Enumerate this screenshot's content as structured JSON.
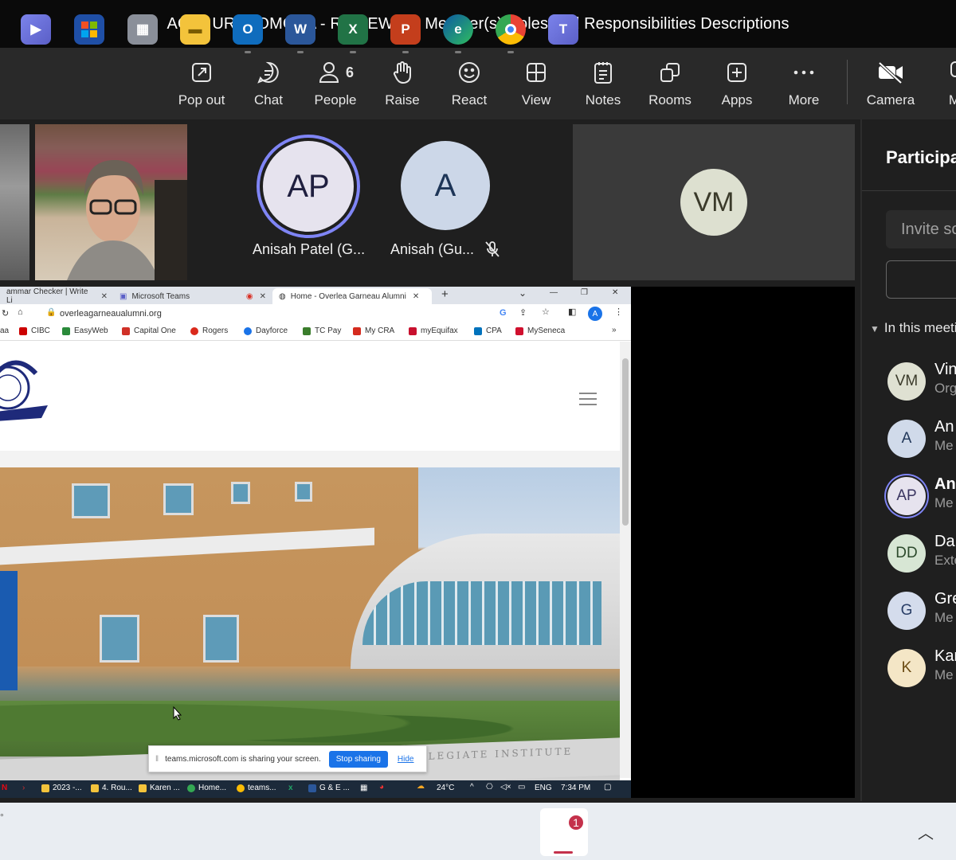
{
  "window": {
    "title": "ACT / URG: OMGAA - REVIEW the Member(s) Roles and Responsibilities Descriptions"
  },
  "toolbar": {
    "popout": "Pop out",
    "chat": "Chat",
    "people": "People",
    "people_count": "6",
    "raise": "Raise",
    "react": "React",
    "view": "View",
    "notes": "Notes",
    "rooms": "Rooms",
    "apps": "Apps",
    "more": "More",
    "camera": "Camera",
    "mic": "M"
  },
  "stage": {
    "ap_initials": "AP",
    "ap_name": "Anisah Patel (G...",
    "a_initials": "A",
    "a_name": "Anisah (Gu...",
    "vm_initials": "VM"
  },
  "browser": {
    "tab1": "ammar Checker | Write Li",
    "tab2": "Microsoft Teams",
    "tab3": "Home - Overlea Garneau Alumni",
    "url": "overleagarneaualumni.org",
    "bookmarks": [
      "aa",
      "CIBC",
      "EasyWeb",
      "Capital One",
      "Rogers",
      "Dayforce",
      "TC Pay",
      "My CRA",
      "myEquifax",
      "CPA",
      "MySeneca"
    ],
    "banner_text": "AU  COLLEGIATE INSTITUTE",
    "share_msg": "teams.microsoft.com is sharing your screen.",
    "stop_sharing": "Stop sharing",
    "hide": "Hide"
  },
  "inner_taskbar": {
    "items": [
      "2023 -...",
      "4. Rou...",
      "Karen ...",
      "Home...",
      "teams...",
      "G & E ..."
    ],
    "temp": "24°C",
    "lang": "ENG",
    "time": "7:34 PM"
  },
  "pane": {
    "title": "Participants",
    "invite_placeholder": "Invite someone",
    "section": "In this meeting",
    "participants": [
      {
        "initials": "VM",
        "name": "Vin",
        "role": "Org",
        "bg": "#dfe1d2",
        "fg": "#3b3b2b"
      },
      {
        "initials": "A",
        "name": "An",
        "role": "Me",
        "bg": "#d0daea",
        "fg": "#22385a"
      },
      {
        "initials": "AP",
        "name": "An",
        "role": "Me",
        "bg": "#e6e3ee",
        "fg": "#3a3560"
      },
      {
        "initials": "DD",
        "name": "Da",
        "role": "Exte",
        "bg": "#d7e6d4",
        "fg": "#2c4a2c"
      },
      {
        "initials": "G",
        "name": "Gre",
        "role": "Me",
        "bg": "#d4dcec",
        "fg": "#283d66"
      },
      {
        "initials": "K",
        "name": "Kar",
        "role": "Me",
        "bg": "#f4e6c6",
        "fg": "#6a4a12"
      }
    ]
  },
  "taskbar": {
    "teams_badge": "1"
  },
  "colors": {
    "accent": "#7f85f5",
    "toolbar_bg": "#292929",
    "stage_bg": "#1f1f1f"
  }
}
